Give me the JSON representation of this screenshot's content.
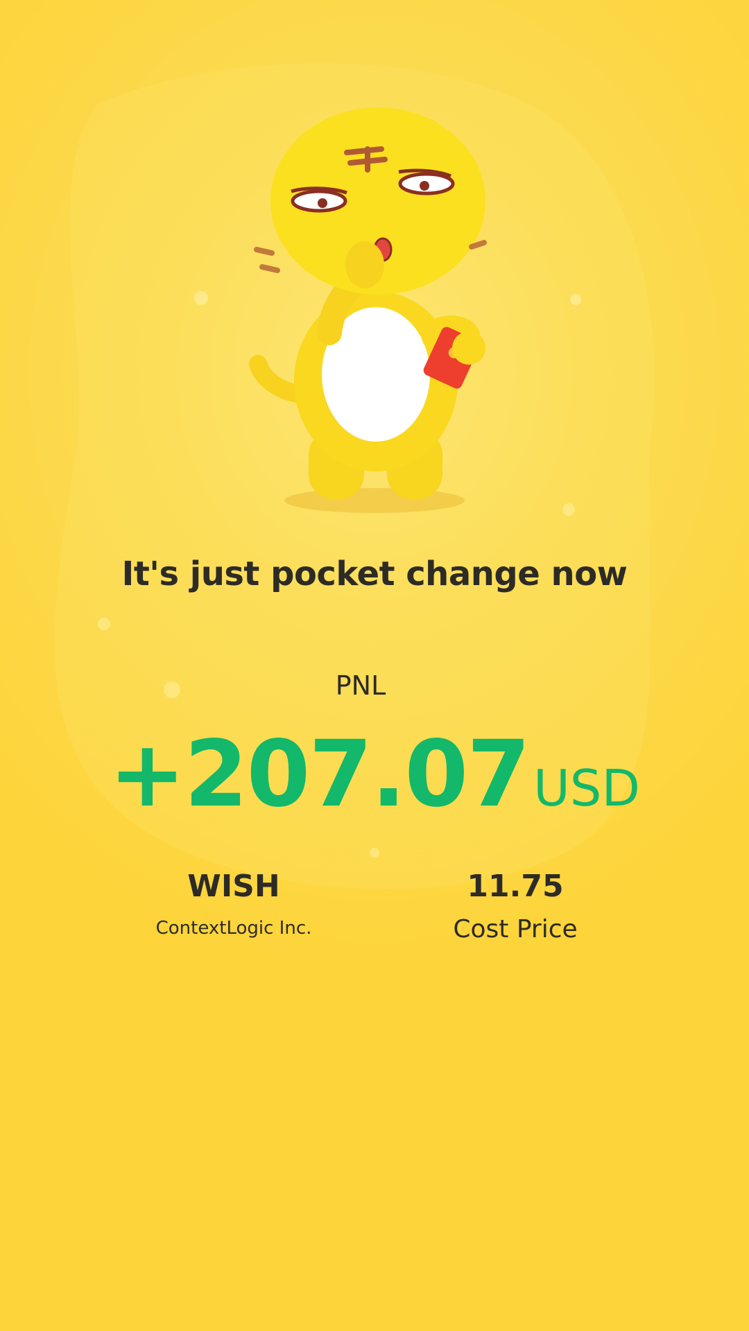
{
  "headline": "It's just pocket change now",
  "pnl": {
    "label": "PNL",
    "amount": "+207.07",
    "currency": "USD"
  },
  "stock": {
    "ticker": "WISH",
    "company": "ContextLogic Inc."
  },
  "cost": {
    "value": "11.75",
    "label": "Cost Price"
  },
  "colors": {
    "background": "#fdd43a",
    "profit_green": "#13b86a",
    "text_dark": "#2d2b26"
  },
  "mascot": {
    "icon": "tiger-mascot-with-red-envelope-icon"
  }
}
